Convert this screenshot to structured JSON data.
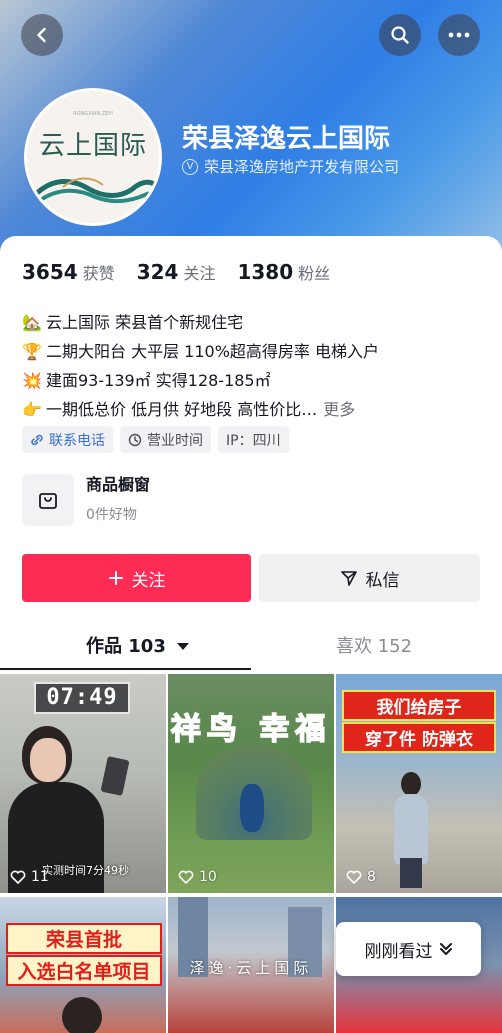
{
  "profile": {
    "name": "荣县泽逸云上国际",
    "company": "荣县泽逸房地产开发有限公司",
    "avatar_text": "云上国际",
    "avatar_subtext": "RONGXIAN ZEYI"
  },
  "stats": [
    {
      "value": "3654",
      "label": "获赞"
    },
    {
      "value": "324",
      "label": "关注"
    },
    {
      "value": "1380",
      "label": "粉丝"
    }
  ],
  "bio": [
    {
      "emoji": "🏡",
      "text": "云上国际   荣县首个新规住宅"
    },
    {
      "emoji": "🏆",
      "text": "二期大阳台 大平层  110%超高得房率  电梯入户"
    },
    {
      "emoji": "💥",
      "text": "建面93-139㎡  实得128-185㎡"
    },
    {
      "emoji": "👉",
      "text": "一期低总价 低月供 好地段 高性价比…",
      "more": "更多"
    }
  ],
  "tags": [
    {
      "icon": "phone-link-icon",
      "label": "联系电话"
    },
    {
      "icon": "clock-icon",
      "label": "营业时间"
    },
    {
      "label": "IP：四川"
    }
  ],
  "shop": {
    "title": "商品橱窗",
    "subtitle": "0件好物"
  },
  "actions": {
    "follow": "关注",
    "message": "私信"
  },
  "tabs": {
    "works": "作品 103",
    "likes": "喜欢 152"
  },
  "videos": [
    {
      "likes": "11",
      "timer": "07:49",
      "caption": "实测时间7分49秒"
    },
    {
      "likes": "10",
      "overlay": "祥鸟 幸福"
    },
    {
      "likes": "8",
      "line1": "我们给房子",
      "line2": "穿了件 防弹衣"
    },
    {
      "line1": "荣县首批",
      "line2": "入选白名单项目"
    },
    {
      "sign": "泽逸·云上国际"
    },
    {}
  ],
  "recent_button": "刚刚看过",
  "colors": {
    "accent": "#fe2c55",
    "header_blue": "#2f7ee6",
    "link_blue": "#3a6fd6"
  }
}
